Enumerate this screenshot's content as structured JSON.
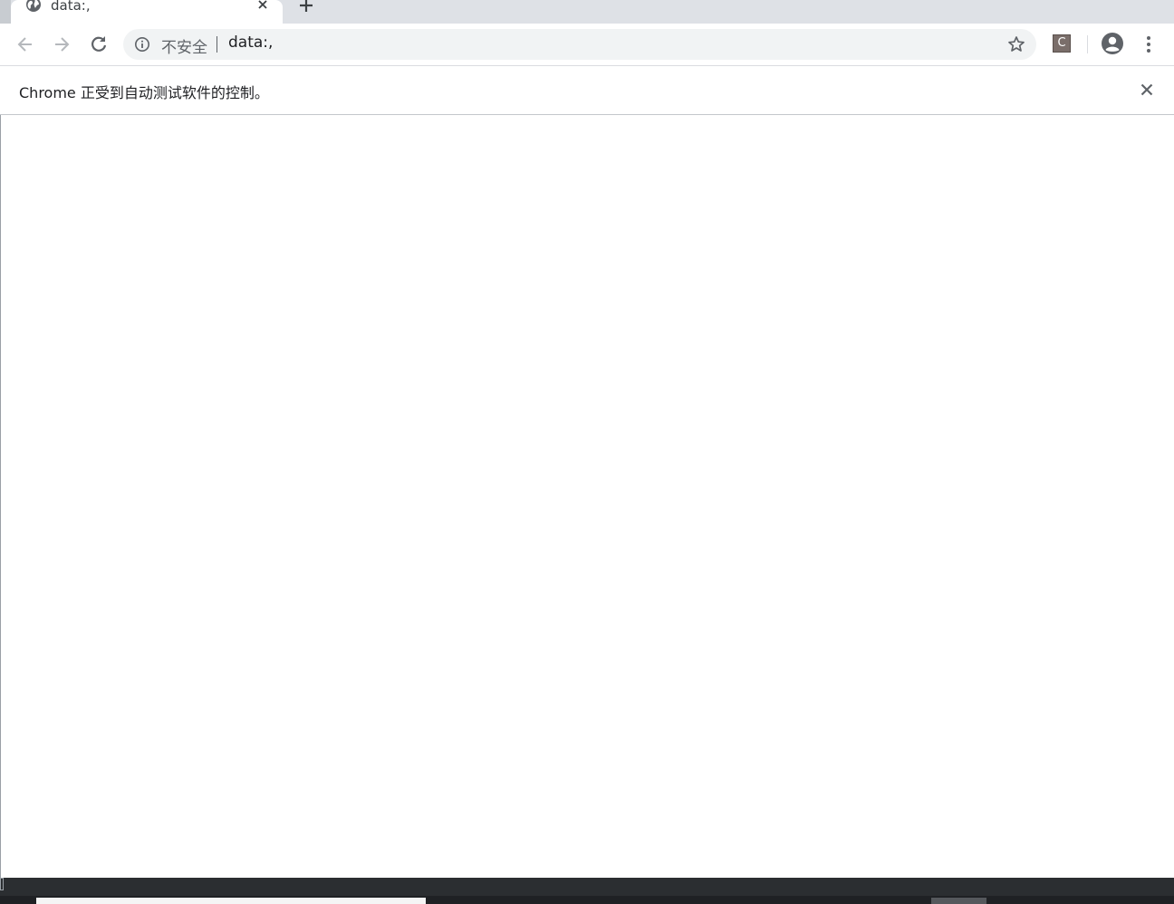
{
  "tab": {
    "title": "data:,",
    "favicon": "globe-icon",
    "close": "close-icon"
  },
  "new_tab": "plus-icon",
  "toolbar": {
    "back": "back-arrow-icon",
    "forward": "forward-arrow-icon",
    "reload": "reload-icon",
    "security_label": "不安全",
    "url": "data:,",
    "bookmark": "star-icon",
    "extension_letter": "C",
    "profile": "account-circle-icon",
    "menu": "more-vert-icon"
  },
  "infobar": {
    "message": "Chrome 正受到自动测试软件的控制。",
    "close": "close-icon"
  },
  "colors": {
    "tabstrip": "#dee1e6",
    "omnibox": "#f1f3f4",
    "icon": "#5f6368",
    "text": "#202124",
    "taskbar": "#2b2e31"
  }
}
